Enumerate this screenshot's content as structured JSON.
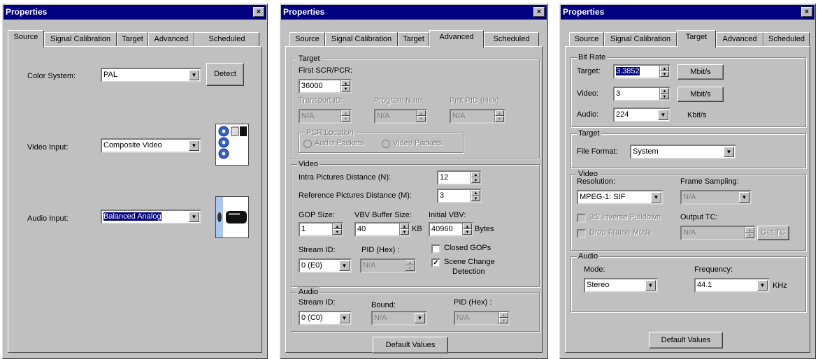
{
  "dialogs": [
    {
      "title": "Properties",
      "close_glyph": "×",
      "tabs": [
        "Source",
        "Signal Calibration",
        "Target",
        "Advanced",
        "Scheduled"
      ],
      "active_tab": "Source",
      "source": {
        "color_system_label": "Color System:",
        "color_system_value": "PAL",
        "detect_button": "Detect",
        "video_input_label": "Video Input:",
        "video_input_value": "Composite Video",
        "video_connector_icon": "composite-rca-connectors-icon",
        "audio_input_label": "Audio Input:",
        "audio_input_value": "Balanced Analog",
        "audio_connector_icon": "balanced-audio-connector-icon"
      }
    },
    {
      "title": "Properties",
      "close_glyph": "×",
      "tabs": [
        "Source",
        "Signal Calibration",
        "Target",
        "Advanced",
        "Scheduled"
      ],
      "active_tab": "Advanced",
      "advanced": {
        "target_group": "Target",
        "first_scr_label": "First SCR/PCR:",
        "first_scr_value": "36000",
        "transport_id_label": "Transport ID:",
        "transport_id_value": "N/A",
        "program_num_label": "Program Num:",
        "program_num_value": "N/A",
        "pmt_pid_label": "Pmt PID (Hex):",
        "pmt_pid_value": "N/A",
        "pcr_location_group": "PCR Location",
        "audio_packets_label": "Audio Packets",
        "video_packets_label": "Video Packets",
        "video_group": "Video",
        "intra_label": "Intra Pictures Distance (N):",
        "intra_value": "12",
        "ref_label": "Reference Pictures Distance (M):",
        "ref_value": "3",
        "gop_label": "GOP Size:",
        "gop_value": "1",
        "vbv_label": "VBV Buffer Size:",
        "vbv_value": "40",
        "vbv_unit": "KB",
        "init_vbv_label": "Initial VBV:",
        "init_vbv_value": "40960",
        "init_vbv_unit": "Bytes",
        "stream_id_label": "Stream ID:",
        "stream_id_value": "0  (E0)",
        "pid_hex_label": "PID (Hex) :",
        "pid_hex_value": "N/A",
        "closed_gops_label": "Closed GOPs",
        "closed_gops_checked": false,
        "scene_change_label_1": "Scene Change",
        "scene_change_label_2": "Detection",
        "scene_change_checked": true,
        "audio_group": "Audio",
        "audio_stream_id_label": "Stream ID:",
        "audio_stream_id_value": "0  (C0)",
        "bound_label": "Bound:",
        "bound_value": "N/A",
        "audio_pid_label": "PID (Hex) :",
        "audio_pid_value": "N/A",
        "default_values_button": "Default Values"
      }
    },
    {
      "title": "Properties",
      "close_glyph": "×",
      "tabs": [
        "Source",
        "Signal Calibration",
        "Target",
        "Advanced",
        "Scheduled"
      ],
      "active_tab": "Target",
      "target": {
        "bitrate_group": "Bit Rate",
        "target_label": "Target:",
        "target_value": "3.3852",
        "target_unit_button": "Mbit/s",
        "video_label": "Video:",
        "video_value": "3",
        "video_unit_button": "Mbit/s",
        "audio_label": "Audio:",
        "audio_value": "224",
        "audio_unit": "Kbit/s",
        "target_group": "Target",
        "file_format_label": "File Format:",
        "file_format_value": "System",
        "video_group": "Video",
        "resolution_label": "Resolution:",
        "resolution_value": "MPEG-1: SIF",
        "frame_sampling_label": "Frame Sampling:",
        "frame_sampling_value": "N/A",
        "inverse_pulldown_label": "3:2 Inverse Pulldown",
        "output_tc_label": "Output TC:",
        "drop_frame_label": "Drop Frame Mode",
        "output_tc_value": "N/A",
        "get_tc_button": "Get TC",
        "audio_group": "Audio",
        "mode_label": "Mode:",
        "mode_value": "Stereo",
        "frequency_label": "Frequency:",
        "frequency_value": "44.1",
        "frequency_unit": "KHz",
        "default_values_button": "Default Values"
      }
    }
  ]
}
